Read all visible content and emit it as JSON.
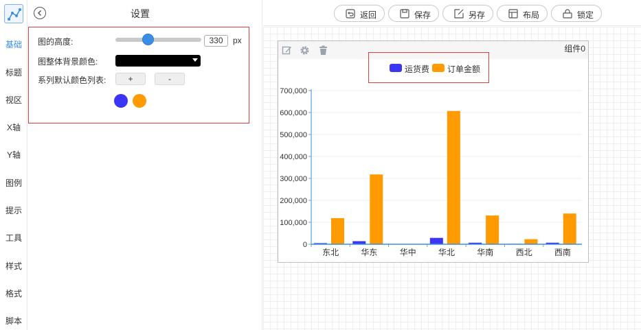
{
  "nav": {
    "items": [
      {
        "label": "基础",
        "active": true
      },
      {
        "label": "标题"
      },
      {
        "label": "视区"
      },
      {
        "label": "X轴"
      },
      {
        "label": "Y轴"
      },
      {
        "label": "图例"
      },
      {
        "label": "提示"
      },
      {
        "label": "工具"
      },
      {
        "label": "样式"
      },
      {
        "label": "格式"
      },
      {
        "label": "脚本"
      }
    ]
  },
  "settings": {
    "title": "设置",
    "height_label": "图的高度:",
    "height_value": "330",
    "height_unit": "px",
    "height_slider_fraction": 0.38,
    "bg_color_label": "图整体背景颜色:",
    "bg_color": "#000000",
    "series_colors_label": "系列默认颜色列表:",
    "add_label": "+",
    "remove_label": "-",
    "series_colors": [
      "#3b36f5",
      "#ff9a00"
    ]
  },
  "toolbar": {
    "back_label": "返回",
    "save_label": "保存",
    "save_as_label": "另存",
    "layout_label": "布局",
    "lock_label": "锁定"
  },
  "widget": {
    "name": "组件0"
  },
  "chart_data": {
    "type": "bar",
    "categories": [
      "东北",
      "华东",
      "华中",
      "华北",
      "华南",
      "西北",
      "西南"
    ],
    "series": [
      {
        "name": "运货费",
        "color": "#3b36f5",
        "values": [
          5000,
          14000,
          800,
          29000,
          7000,
          2000,
          7000
        ]
      },
      {
        "name": "订单金额",
        "color": "#ff9a00",
        "values": [
          119000,
          318000,
          0,
          607000,
          131000,
          23000,
          140000
        ]
      }
    ],
    "yticks": [
      "0",
      "100,000",
      "200,000",
      "300,000",
      "400,000",
      "500,000",
      "600,000",
      "700,000"
    ],
    "ylim": [
      0,
      700000
    ],
    "legend_position": "top-center",
    "grid": true
  }
}
